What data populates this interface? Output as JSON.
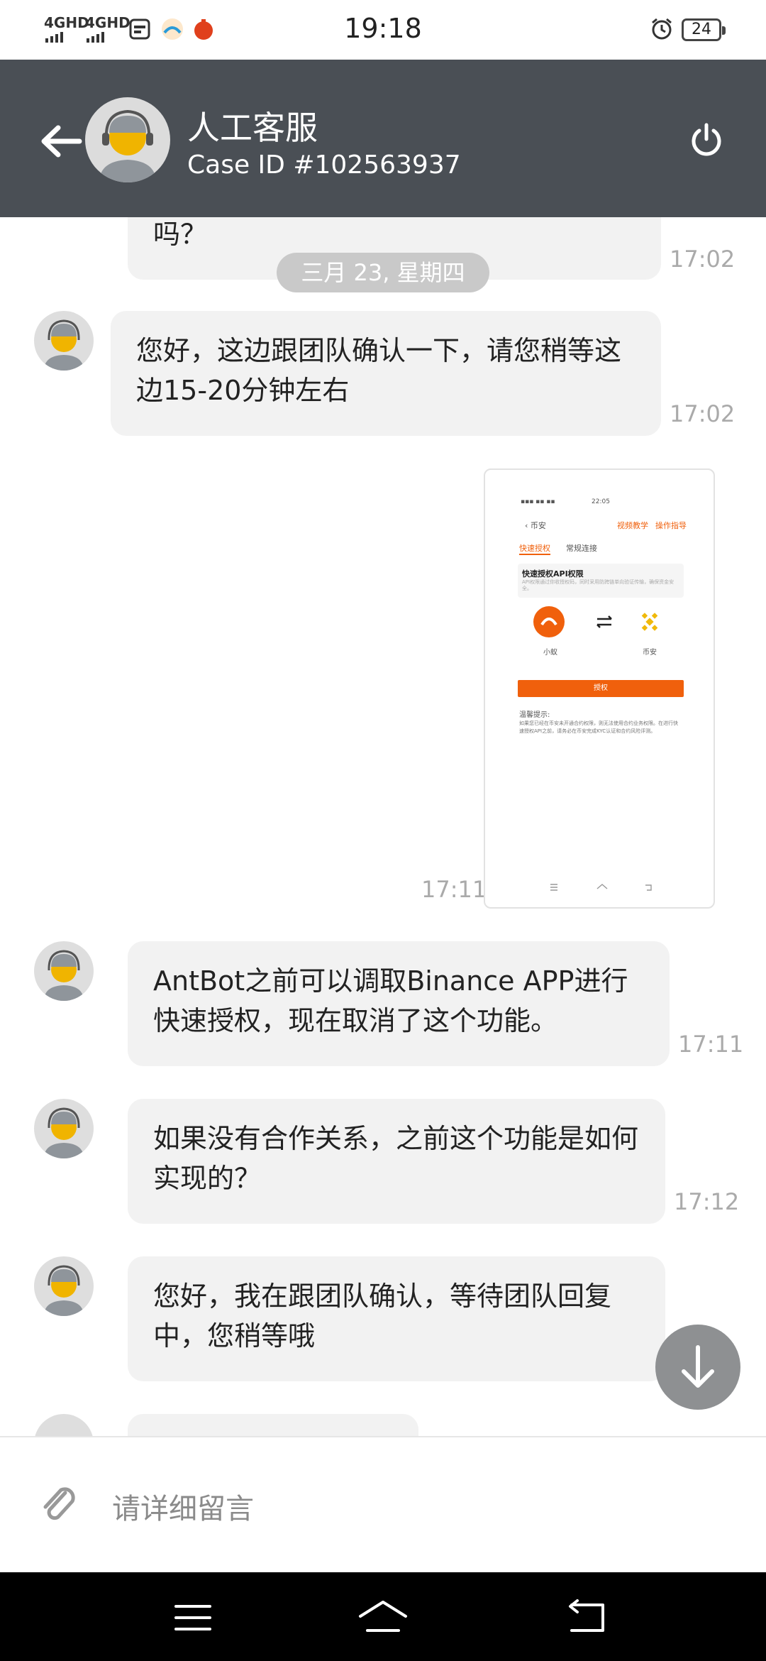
{
  "status_bar": {
    "signal1": "4GHD",
    "signal2": "4GHD",
    "time": "19:18",
    "battery": "24",
    "icons": [
      "sim-card-icon",
      "app-icon-a",
      "app-icon-b",
      "alarm-icon"
    ]
  },
  "header": {
    "title": "人工客服",
    "case_id": "Case ID #102563937",
    "back_icon": "arrow-left-icon",
    "power_icon": "power-icon"
  },
  "chat": {
    "date_divider": "三月 23, 星期四",
    "messages": [
      {
        "text": "吗？",
        "time": "17:02"
      },
      {
        "text": "您好，这边跟团队确认一下，请您稍等这边15-20分钟左右",
        "time": "17:02"
      },
      {
        "type": "image",
        "time": "17:11"
      },
      {
        "text": "AntBot之前可以调取Binance APP进行快速授权，现在取消了这个功能。",
        "time": "17:11"
      },
      {
        "text": "如果没有合作关系，之前这个功能是如何实现的？",
        "time": "17:12"
      },
      {
        "text": "您好，我在跟团队确认，等待团队回复中，您稍等哦",
        "time": ""
      }
    ]
  },
  "image_preview": {
    "status_time": "22:05",
    "back_label": "币安",
    "link1": "视频教学",
    "link2": "操作指导",
    "tab_active": "快速授权",
    "tab_other": "常规连接",
    "card_title": "快速授权API权限",
    "card_desc": "API权限通过你收授权码，同时采用防跨链单向验证传输，确保资金安全。",
    "left_app": "小蚁",
    "right_app": "币安",
    "button": "授权",
    "tips_title": "温馨提示:",
    "tips_text": "如果您已经在币安未开通合约权限，则无法使用合约业务权限。在进行快速授权API之前，请务必在币安完成KYC认证和合约风险评测。"
  },
  "input": {
    "placeholder": "请详细留言",
    "attach_icon": "paperclip-icon"
  },
  "fab_icon": "arrow-down-icon",
  "navbar": [
    "menu-icon",
    "home-icon",
    "back-icon"
  ],
  "colors": {
    "header_bg": "#4a4f55",
    "bubble_bg": "#f2f2f2",
    "accent_orange": "#f0600c",
    "binance_yellow": "#f0b90b"
  }
}
